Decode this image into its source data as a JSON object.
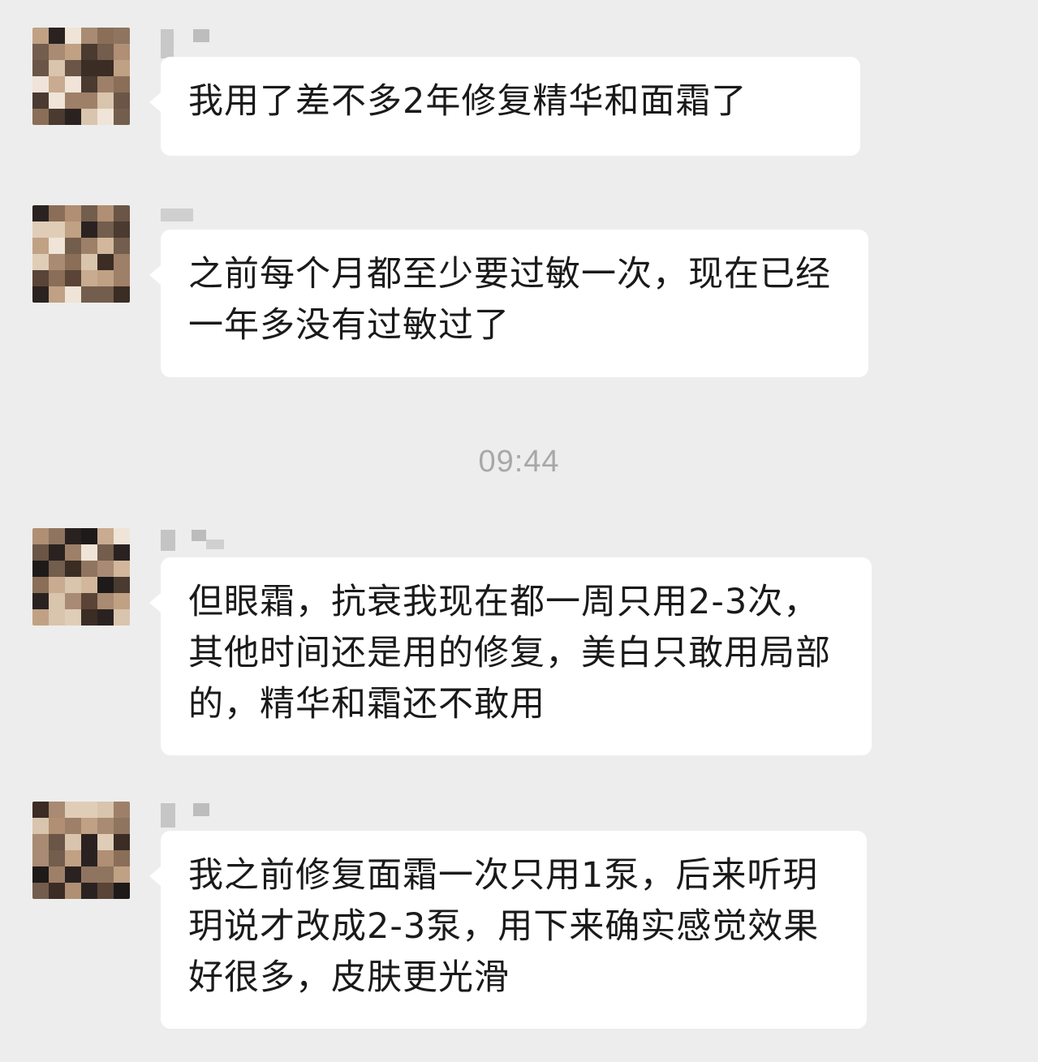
{
  "messages": [
    {
      "text": "我用了差不多2年修复精华和面霜了"
    },
    {
      "text": "之前每个月都至少要过敏一次，现在已经一年多没有过敏过了"
    },
    {
      "text": "但眼霜，抗衰我现在都一周只用2-3次，其他时间还是用的修复，美白只敢用局部的，精华和霜还不敢用"
    },
    {
      "text": "我之前修复面霜一次只用1泵，后来听玥玥说才改成2-3泵，用下来确实感觉效果好很多，皮肤更光滑"
    }
  ],
  "timestamp": "09:44",
  "colors": {
    "background": "#ededed",
    "bubble": "#ffffff",
    "text": "#1a1a1a",
    "timestamp": "#a8a8a8"
  }
}
